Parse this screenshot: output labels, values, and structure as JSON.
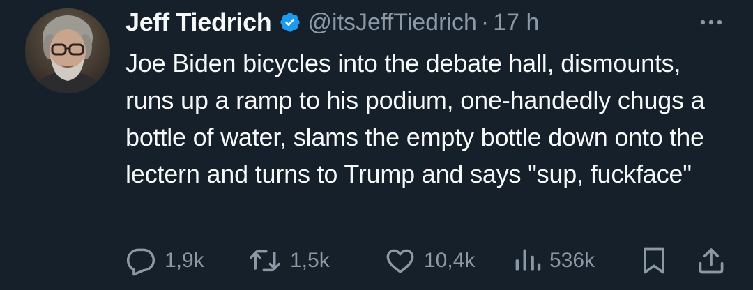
{
  "author": {
    "display_name": "Jeff Tiedrich",
    "handle": "@itsJeffTiedrich",
    "separator": "·",
    "time": "17 h",
    "verified": true
  },
  "tweet": {
    "text": "Joe Biden bicycles into the debate hall, dismounts, runs up a ramp to his podium, one-handedly chugs a bottle of water, slams the empty bottle down onto the lectern and turns to Trump and says \"sup, fuckface\""
  },
  "actions": {
    "replies": "1,9k",
    "reposts": "1,5k",
    "likes": "10,4k",
    "views": "536k"
  },
  "icons": {
    "verified": "verified-badge-icon",
    "more": "more-options-icon",
    "reply": "reply-icon",
    "repost": "repost-icon",
    "like": "like-icon",
    "views": "views-icon",
    "bookmark": "bookmark-icon",
    "share": "share-icon"
  },
  "colors": {
    "background": "#15202b",
    "text": "#f7f9f9",
    "secondary_text": "#8b98a5",
    "verified_blue": "#1d9bf0"
  }
}
